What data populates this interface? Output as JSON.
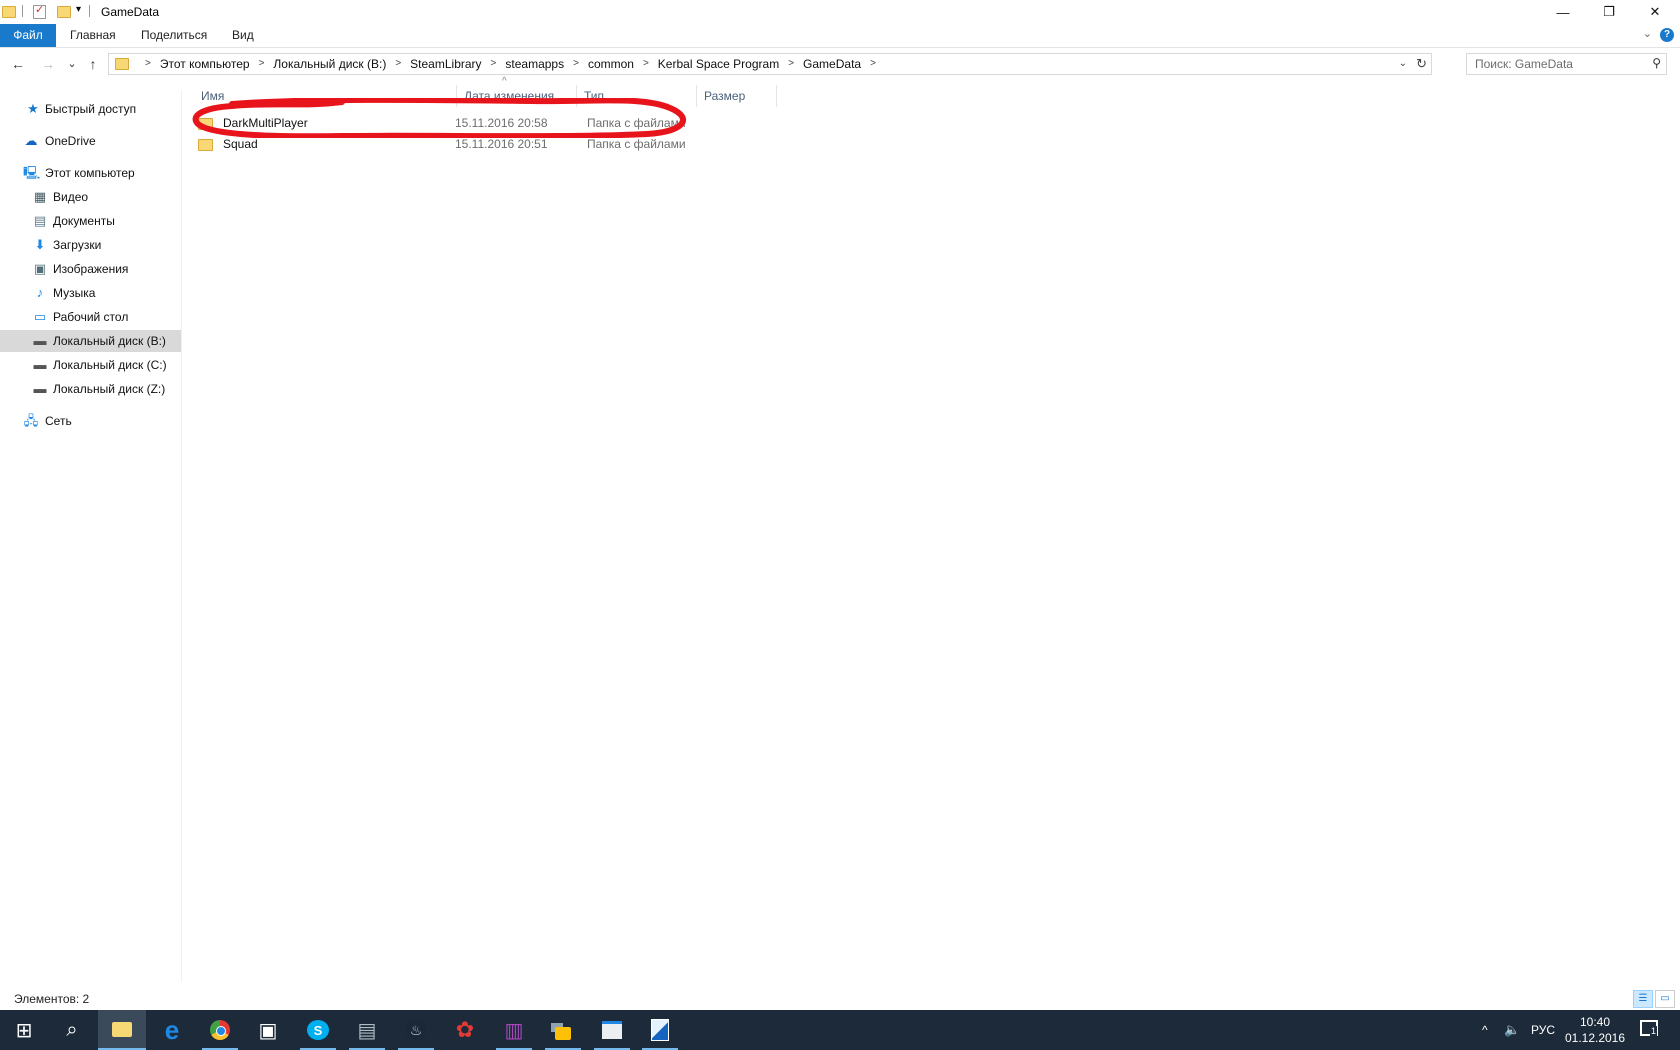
{
  "window": {
    "title": "GameData",
    "controls": {
      "minimize": "—",
      "restore": "❐",
      "close": "✕"
    }
  },
  "ribbon": {
    "tabs": [
      {
        "label": "Файл",
        "active": true
      },
      {
        "label": "Главная"
      },
      {
        "label": "Поделиться"
      },
      {
        "label": "Вид"
      }
    ],
    "help": "?"
  },
  "navigation": {
    "back": "←",
    "forward": "→",
    "recent": "⌄",
    "up": "↑",
    "breadcrumbs": [
      "Этот компьютер",
      "Локальный диск (B:)",
      "SteamLibrary",
      "steamapps",
      "common",
      "Kerbal Space Program",
      "GameData"
    ],
    "search_placeholder": "Поиск: GameData"
  },
  "sidebar": {
    "items": [
      {
        "label": "Быстрый доступ",
        "icon": "star-icon",
        "glyph": "★"
      },
      {
        "label": "OneDrive",
        "icon": "cloud-icon",
        "glyph": "☁"
      },
      {
        "label": "Этот компьютер",
        "icon": "computer-icon",
        "glyph": "🖳"
      },
      {
        "label": "Видео",
        "icon": "video-icon",
        "glyph": "▦"
      },
      {
        "label": "Документы",
        "icon": "document-icon",
        "glyph": "▤"
      },
      {
        "label": "Загрузки",
        "icon": "download-icon",
        "glyph": "⬇"
      },
      {
        "label": "Изображения",
        "icon": "image-icon",
        "glyph": "▣"
      },
      {
        "label": "Музыка",
        "icon": "music-icon",
        "glyph": "♪"
      },
      {
        "label": "Рабочий стол",
        "icon": "desktop-icon",
        "glyph": "▭"
      },
      {
        "label": "Локальный диск (B:)",
        "icon": "drive-icon",
        "glyph": "▬",
        "selected": true
      },
      {
        "label": "Локальный диск (C:)",
        "icon": "windows-drive-icon",
        "glyph": "▬"
      },
      {
        "label": "Локальный диск (Z:)",
        "icon": "drive-icon",
        "glyph": "▬"
      },
      {
        "label": "Сеть",
        "icon": "network-icon",
        "glyph": "🖧"
      }
    ]
  },
  "file_list": {
    "columns": [
      "Имя",
      "Дата изменения",
      "Тип",
      "Размер"
    ],
    "sort_indicator": "^",
    "rows": [
      {
        "name": "DarkMultiPlayer",
        "date": "15.11.2016 20:58",
        "type": "Папка с файлами",
        "size": ""
      },
      {
        "name": "Squad",
        "date": "15.11.2016 20:51",
        "type": "Папка с файлами",
        "size": ""
      }
    ],
    "annotation_color": "#e8141b"
  },
  "status_bar": {
    "item_count": "Элементов: 2"
  },
  "taskbar": {
    "apps": [
      {
        "name": "start-button",
        "glyph": "⊞"
      },
      {
        "name": "search",
        "glyph": "⌕"
      },
      {
        "name": "file-explorer",
        "glyph": "▬",
        "color": "#f8d775"
      },
      {
        "name": "edge",
        "glyph": "e",
        "color": "#1e88e5"
      },
      {
        "name": "chrome",
        "glyph": "◉",
        "color": "#e53935"
      },
      {
        "name": "store",
        "glyph": "▣",
        "color": "#ffffff"
      },
      {
        "name": "skype",
        "glyph": "S",
        "color": "#00aff0"
      },
      {
        "name": "network-app",
        "glyph": "▤",
        "color": "#9aa7b4"
      },
      {
        "name": "steam",
        "glyph": "♨",
        "color": "#cfd8dc"
      },
      {
        "name": "red-app",
        "glyph": "✿",
        "color": "#e53935"
      },
      {
        "name": "winrar",
        "glyph": "▥",
        "color": "#8e5aa8"
      },
      {
        "name": "lock-app",
        "glyph": "🔒",
        "color": "#ffc107"
      },
      {
        "name": "window-app",
        "glyph": "▢",
        "color": "#cfd8dc"
      },
      {
        "name": "ksp-app",
        "glyph": "◪",
        "color": "#90caf9"
      }
    ],
    "tray": {
      "chevron": "^",
      "volume": "🔊",
      "language": "РУС",
      "time": "10:40",
      "date": "01.12.2016",
      "notification_count": "1"
    }
  }
}
